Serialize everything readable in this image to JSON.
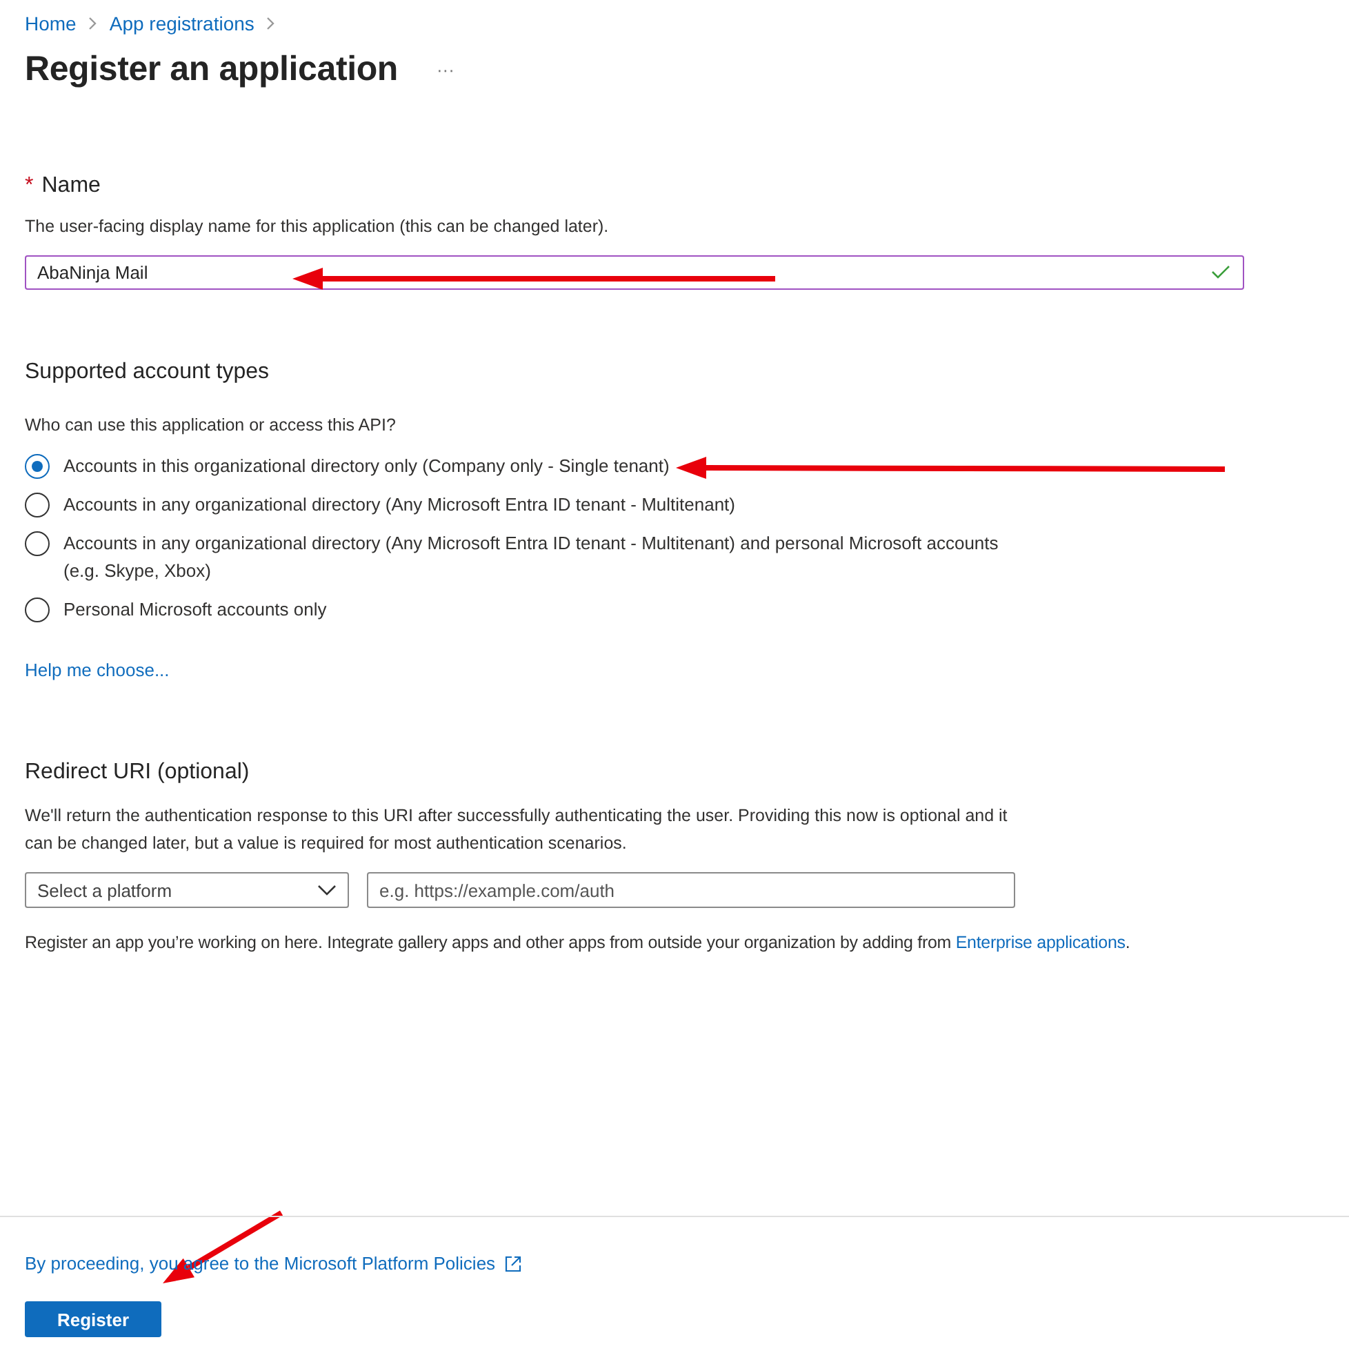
{
  "breadcrumb": [
    {
      "label": "Home"
    },
    {
      "label": "App registrations"
    }
  ],
  "title": "Register an application",
  "more_button": "···",
  "name_section": {
    "label": "Name",
    "required_mark": "*",
    "description": "The user-facing display name for this application (this can be changed later).",
    "value": "AbaNinja Mail",
    "valid": true
  },
  "account_types": {
    "heading": "Supported account types",
    "question": "Who can use this application or access this API?",
    "options": [
      {
        "label": "Accounts in this organizational directory only (Company only - Single tenant)",
        "selected": true
      },
      {
        "label": "Accounts in any organizational directory (Any Microsoft Entra ID tenant - Multitenant)",
        "selected": false
      },
      {
        "label": "Accounts in any organizational directory (Any Microsoft Entra ID tenant - Multitenant) and personal Microsoft accounts (e.g. Skype, Xbox)",
        "selected": false
      },
      {
        "label": "Personal Microsoft accounts only",
        "selected": false
      }
    ],
    "help_link": "Help me choose..."
  },
  "redirect_uri": {
    "heading": "Redirect URI (optional)",
    "description": "We'll return the authentication response to this URI after successfully authenticating the user. Providing this now is optional and it can be changed later, but a value is required for most authentication scenarios.",
    "platform_placeholder": "Select a platform",
    "uri_placeholder": "e.g. https://example.com/auth"
  },
  "note": {
    "text": "Register an app you’re working on here. Integrate gallery apps and other apps from outside your organization by adding from ",
    "link": "Enterprise applications",
    "end": "."
  },
  "footer": {
    "policy_link": "By proceeding, you agree to the Microsoft Platform Policies",
    "button": "Register"
  },
  "annotations": [
    {
      "kind": "arrow"
    },
    {
      "kind": "arrow"
    },
    {
      "kind": "arrow"
    }
  ]
}
